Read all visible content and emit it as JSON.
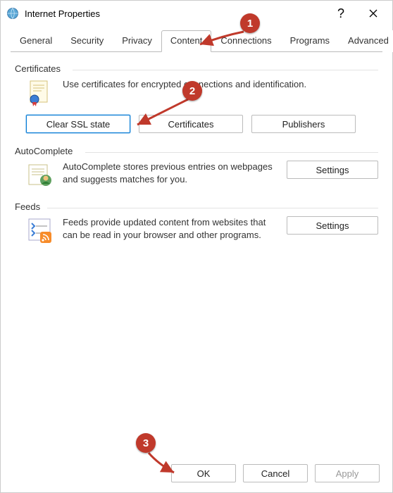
{
  "title": "Internet Properties",
  "titlebar": {
    "help_label": "?",
    "close_label": "×"
  },
  "tabs": {
    "general": "General",
    "security": "Security",
    "privacy": "Privacy",
    "content": "Content",
    "connections": "Connections",
    "programs": "Programs",
    "advanced": "Advanced",
    "active": "content"
  },
  "certificates": {
    "heading": "Certificates",
    "description": "Use certificates for encrypted connections and identification.",
    "clear_ssl_label": "Clear SSL state",
    "certificates_label": "Certificates",
    "publishers_label": "Publishers"
  },
  "autocomplete": {
    "heading": "AutoComplete",
    "description": "AutoComplete stores previous entries on webpages and suggests matches for you.",
    "settings_label": "Settings"
  },
  "feeds": {
    "heading": "Feeds",
    "description": "Feeds provide updated content from websites that can be read in your browser and other programs.",
    "settings_label": "Settings"
  },
  "footer": {
    "ok_label": "OK",
    "cancel_label": "Cancel",
    "apply_label": "Apply"
  },
  "annotations": {
    "n1": "1",
    "n2": "2",
    "n3": "3"
  }
}
